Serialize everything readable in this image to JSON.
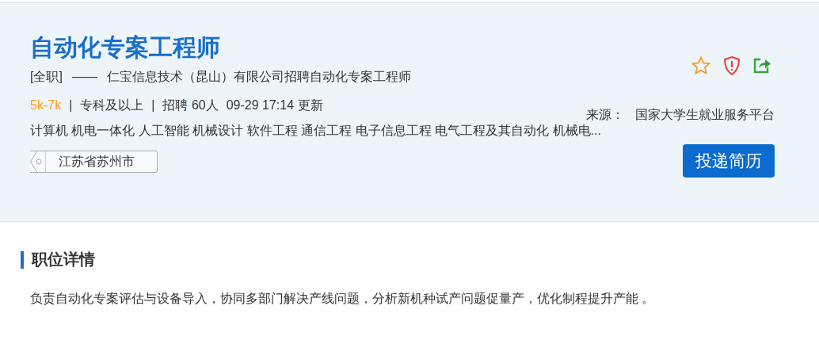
{
  "job": {
    "title": "自动化专案工程师",
    "employment_type": "[全职]",
    "dash": "——",
    "company_line": "仁宝信息技术（昆山）有限公司招聘自动化专案工程师",
    "meta": [
      {
        "kind": "salary",
        "text": "5k-7k"
      },
      {
        "kind": "separator",
        "text": "|"
      },
      {
        "kind": "text",
        "text": "专科及以上"
      },
      {
        "kind": "separator",
        "text": "|"
      },
      {
        "kind": "text",
        "text": "招聘 60人"
      },
      {
        "kind": "text",
        "text": "09-29 17:14 更新"
      }
    ],
    "majors": "计算机 机电一体化 人工智能 机械设计 软件工程 通信工程 电子信息工程 电气工程及其自动化 机械电...",
    "location": "江苏省苏州市"
  },
  "source": {
    "label": "来源：",
    "value": "国家大学生就业服务平台"
  },
  "apply_button": "投递简历",
  "details": {
    "title": "职位详情",
    "description": "负责自动化专案评估与设备导入，协同多部门解决产线问题，分析新机种试产问题促量产，优化制程提升产能 。"
  }
}
